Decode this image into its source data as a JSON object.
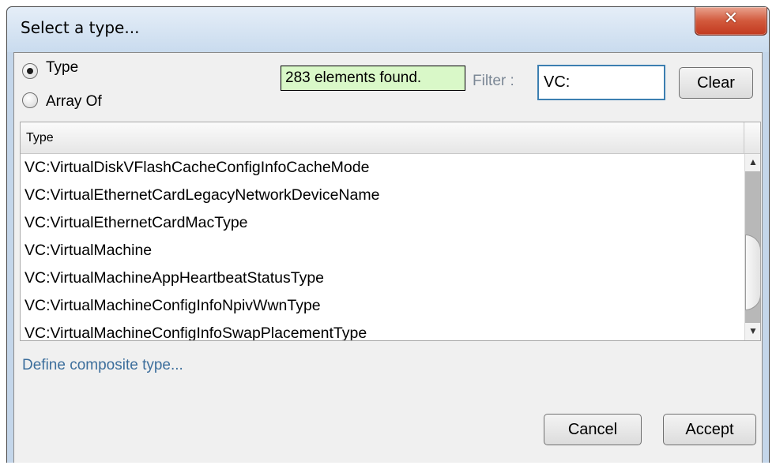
{
  "window": {
    "title": "Select a type...",
    "close_icon": "x-icon"
  },
  "options": {
    "type_label": "Type",
    "array_label": "Array Of",
    "selected": "Type"
  },
  "status": {
    "count_text": "283 elements found."
  },
  "filter": {
    "label": "Filter :",
    "value": "VC:",
    "clear_label": "Clear"
  },
  "table": {
    "column_header": "Type",
    "rows": [
      "VC:VirtualDiskVFlashCacheConfigInfoCacheMode",
      "VC:VirtualEthernetCardLegacyNetworkDeviceName",
      "VC:VirtualEthernetCardMacType",
      "VC:VirtualMachine",
      "VC:VirtualMachineAppHeartbeatStatusType",
      "VC:VirtualMachineConfigInfoNpivWwnType",
      "VC:VirtualMachineConfigInfoSwapPlacementType"
    ]
  },
  "composite_link": "Define composite type...",
  "buttons": {
    "cancel": "Cancel",
    "accept": "Accept"
  },
  "colors": {
    "badge_bg": "#d9f8c8",
    "link": "#3c6e9c",
    "titlebar": "#c9dbee",
    "close_button": "#c2391f"
  }
}
